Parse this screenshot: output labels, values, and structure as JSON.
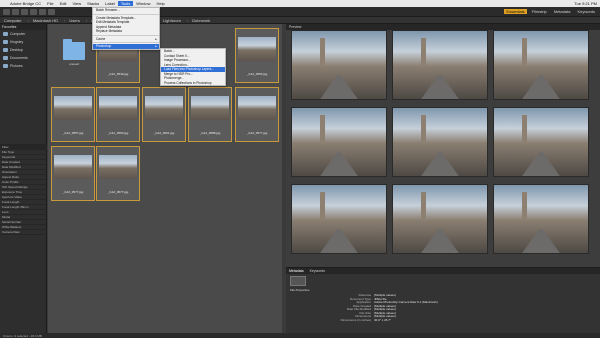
{
  "mac_menu": {
    "items": [
      "Adobe Bridge CC",
      "File",
      "Edit",
      "View",
      "Stacks",
      "Label",
      "Tools",
      "Window",
      "Help"
    ],
    "active_index": 6,
    "right_status": "Tue 9:21 PM"
  },
  "window_title": "Adobe Bridge",
  "workspace_tabs": [
    "Essentials",
    "Filmstrip",
    "Metadata",
    "Keywords"
  ],
  "workspace_active": 0,
  "path": [
    "Computer",
    "Macintosh HD",
    "Users",
    "dropbox",
    "Dropbox (Personal)",
    "Lightroom",
    "Dubrovnik"
  ],
  "left_panel": {
    "tab": "Favorites",
    "favorites": [
      "Computer",
      "Kingsley",
      "Desktop",
      "Documents",
      "Pictures"
    ],
    "filter_tab": "Filter",
    "filters": [
      "File Type",
      "Keywords",
      "Date Created",
      "Date Modified",
      "Orientation",
      "Aspect Ratio",
      "Color Profile",
      "ISO Speed Ratings",
      "Exposure Time",
      "Aperture Value",
      "Focal Length",
      "Focal Length 35mm",
      "Lens",
      "Model",
      "Serial Number",
      "White Balance",
      "Camera Raw"
    ]
  },
  "content": {
    "folder_label": "unused",
    "thumbs": [
      {
        "name": "_G12_0549.jpg"
      },
      {
        "name": "_G12_0553.jpg"
      },
      {
        "name": "_G12_0557.jpg"
      },
      {
        "name": "_G12_0553.jpg"
      },
      {
        "name": "_G12_0591.jpg"
      },
      {
        "name": "_G12_0588.jpg"
      },
      {
        "name": "_G12_0577.jpg"
      },
      {
        "name": "_G12_0577.jpg"
      },
      {
        "name": "_G12_0577.jpg"
      }
    ]
  },
  "tools_menu": {
    "items": [
      "Batch Rename...",
      "Create Metadata Template...",
      "Edit Metadata Template",
      "Append Metadata",
      "Replace Metadata",
      "Cache",
      "Photoshop"
    ],
    "highlighted": "Photoshop"
  },
  "photoshop_submenu": {
    "items": [
      "Batch...",
      "Contact Sheet II...",
      "Image Processor...",
      "Lens Correction...",
      "Load Files into Photoshop Layers...",
      "Merge to HDR Pro...",
      "Photomerge...",
      "Process Collections in Photoshop"
    ],
    "highlighted_index": 4
  },
  "preview": {
    "tab": "Preview"
  },
  "metadata": {
    "tabs": [
      "Metadata",
      "Keywords"
    ],
    "section": "File Properties",
    "rows": [
      {
        "k": "Filename",
        "v": "(Multiple values)"
      },
      {
        "k": "Document Type",
        "v": "JPEG file"
      },
      {
        "k": "Application",
        "v": "Adobe Photoshop Camera Raw 9.1 (Macintosh)"
      },
      {
        "k": "Date Created",
        "v": "(Multiple values)"
      },
      {
        "k": "Date File Modified",
        "v": "(Multiple values)"
      },
      {
        "k": "File Size",
        "v": "(Multiple values)"
      },
      {
        "k": "Dimensions",
        "v": "(Multiple values)"
      },
      {
        "k": "Dimensions (in inches)",
        "v": "40.0\" x 26.7\""
      }
    ]
  },
  "status_bar": "9 items, 9 selected - 28.3 MB"
}
